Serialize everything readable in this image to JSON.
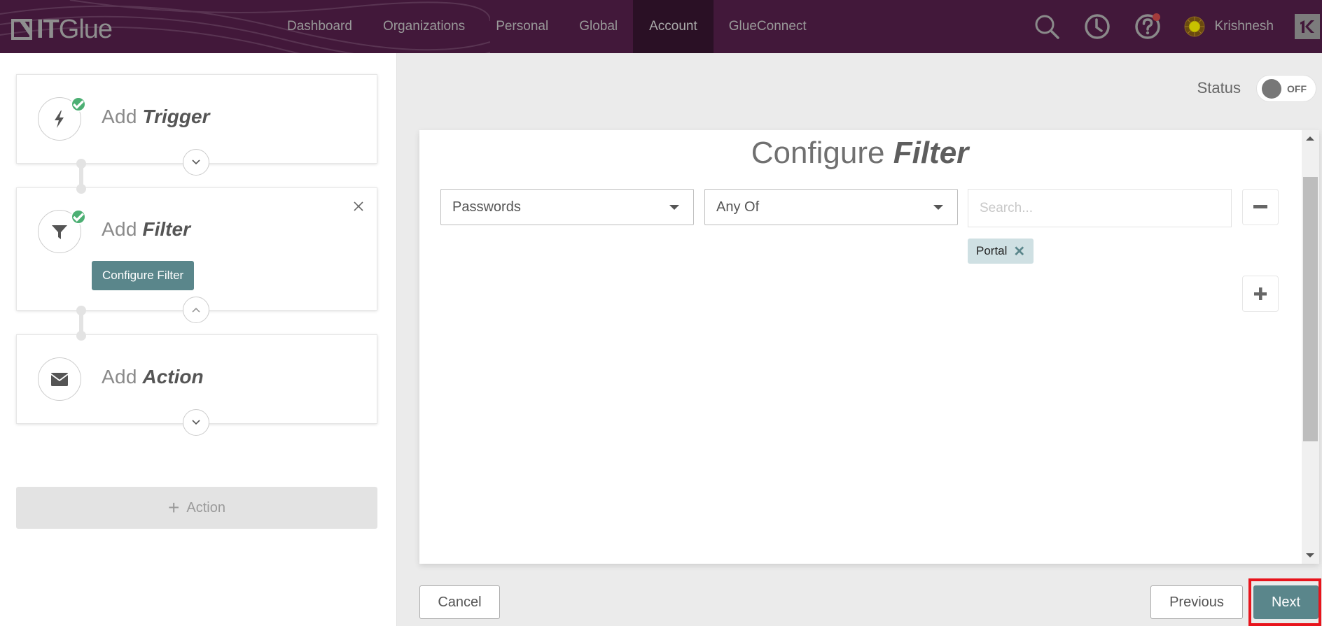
{
  "app": {
    "logo_text_bold": "IT",
    "logo_text_light": "Glue"
  },
  "nav": {
    "items": [
      {
        "label": "Dashboard",
        "active": false
      },
      {
        "label": "Organizations",
        "active": false
      },
      {
        "label": "Personal",
        "active": false
      },
      {
        "label": "Global",
        "active": false
      },
      {
        "label": "Account",
        "active": true
      },
      {
        "label": "GlueConnect",
        "active": false
      }
    ],
    "icons": [
      "search-icon",
      "history-clock-icon",
      "help-icon"
    ],
    "user_name": "Krishnesh",
    "brand_badge": "K",
    "colors": {
      "nav_bg": "#42183a",
      "nav_active_bg": "#2a1025",
      "notification_dot": "#a43b3b"
    }
  },
  "workflow": {
    "steps": [
      {
        "prefix": "Add",
        "name": "Trigger",
        "icon": "lightning-bolt-icon",
        "completed": true,
        "toggle": "expand"
      },
      {
        "prefix": "Add",
        "name": "Filter",
        "icon": "filter-funnel-icon",
        "completed": true,
        "toggle": "collapse",
        "button_label": "Configure Filter",
        "removable": true
      },
      {
        "prefix": "Add",
        "name": "Action",
        "icon": "envelope-icon",
        "completed": false,
        "toggle": "expand"
      }
    ],
    "add_action_label": "Action"
  },
  "status": {
    "label": "Status",
    "toggle_text": "OFF",
    "enabled": false
  },
  "configure_panel": {
    "title_light": "Configure",
    "title_strong": "Filter",
    "resource_select": {
      "value": "Passwords"
    },
    "operator_select": {
      "value": "Any Of"
    },
    "search": {
      "placeholder": "Search...",
      "value": ""
    },
    "tags": [
      {
        "label": "Portal"
      }
    ],
    "remove_button": "−",
    "add_button": "+"
  },
  "footer": {
    "cancel_label": "Cancel",
    "previous_label": "Previous",
    "next_label": "Next"
  },
  "colors": {
    "accent": "#5a868b",
    "check_green": "#4caf73",
    "tag_bg": "#cfe0e3",
    "highlight": "#e8141c"
  }
}
